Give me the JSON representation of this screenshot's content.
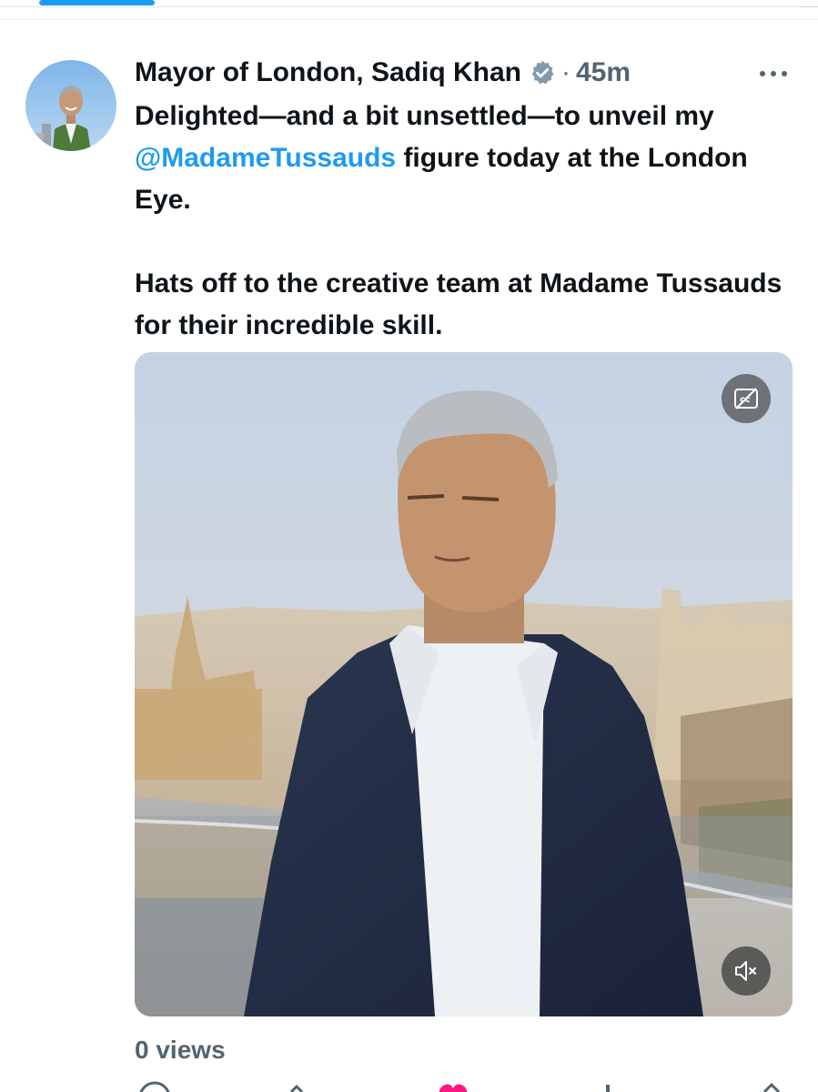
{
  "header": {
    "display_name": "Mayor of London, Sadiq Khan",
    "separator": "·",
    "timestamp": "45m"
  },
  "icons": {
    "verified": "verified-badge-icon",
    "more": "more-dots-icon",
    "captions": "closed-captions-icon",
    "mute": "speaker-muted-icon",
    "reply": "reply-icon",
    "retweet": "retweet-icon",
    "like": "heart-icon",
    "views": "views-icon",
    "share": "share-icon"
  },
  "tweet": {
    "line1_pre": "Delighted—and a bit unsettled—to unveil my ",
    "mention": "@MadameTussauds",
    "line1_post": " figure today at the London Eye.",
    "paragraph2": "Hats off to the creative team at Madame Tussauds for their incredible skill."
  },
  "stats": {
    "views_count": "0",
    "views_label": "views"
  },
  "colors": {
    "accent": "#1d9bf0",
    "text": "#0f1419",
    "secondary": "#536471",
    "like": "#f91880"
  }
}
